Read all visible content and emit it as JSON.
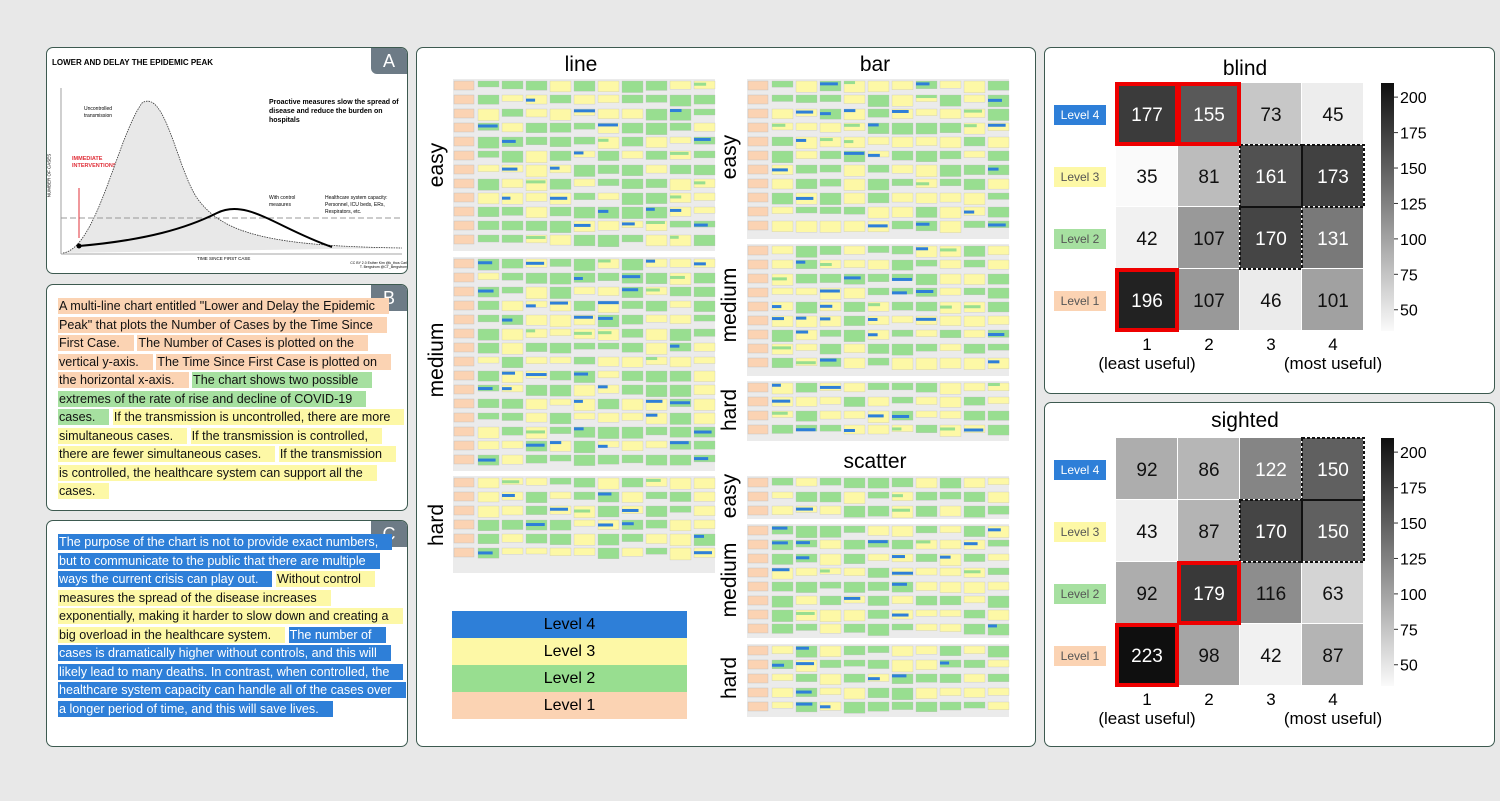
{
  "panel_a": {
    "tag": "A",
    "title": "LOWER AND DELAY THE EPIDEMIC PEAK",
    "subtitle": "Proactive measures slow the spread of disease and reduce the burden on hospitals",
    "uncontrolled": "Uncontrolled transmission",
    "interventions": "IMMEDIATE INTERVENTIONS",
    "control": "With control measures",
    "capacity": "Healthcare system capacity: Personnel, ICU beds, ERs, Respirators, etc.",
    "ylabel": "NUMBER OF CASES",
    "xlabel": "TIME SINCE FIRST CASE",
    "credit": "CC BY 2.0 Esther Kim @k_thos Carl T. Bergstrom @CT_Bergstrom"
  },
  "panel_b": {
    "tag": "B",
    "sentences": [
      {
        "text": "A multi-line chart entitled \"Lower and Delay the Epidemic Peak\" that plots the Number of Cases by the Time Since First Case.",
        "level": "Level 1"
      },
      {
        "text": "The Number of Cases is plotted on the vertical y-axis.",
        "level": "Level 1"
      },
      {
        "text": "The Time Since First Case is plotted on the horizontal x-axis.",
        "level": "Level 1"
      },
      {
        "text": "The chart shows two possible extremes of the rate of rise and decline of COVID-19 cases.",
        "level": "Level 2"
      },
      {
        "text": "If the transmission is uncontrolled, there are more simultaneous cases.",
        "level": "Level 3"
      },
      {
        "text": "If the transmission is controlled, there are fewer simultaneous cases.",
        "level": "Level 3"
      },
      {
        "text": "If the transmission is controlled, the healthcare system can support all the cases.",
        "level": "Level 3"
      }
    ]
  },
  "panel_c": {
    "tag": "C",
    "sentences": [
      {
        "text": "The purpose of the chart is not to provide exact numbers, but to communicate to the public that there are multiple ways the current crisis can play out.",
        "level": "Level 4"
      },
      {
        "text": "Without control measures the spread of the disease increases exponentially, making it harder to slow down and creating a big overload in the healthcare system.",
        "level": "Level 3"
      },
      {
        "text": "The number of cases is dramatically higher without controls, and this will likely lead to many deaths. In contrast, when controlled, the healthcare system capacity can handle all of the cases over a longer period of time, and this will save lives.",
        "level": "Level 4"
      }
    ]
  },
  "middle": {
    "line_title": "line",
    "bar_title": "bar",
    "scatter_title": "scatter",
    "easy": "easy",
    "medium": "medium",
    "hard": "hard",
    "legend": [
      {
        "label": "Level 4",
        "color": "#2e7fd8"
      },
      {
        "label": "Level 3",
        "color": "#fdf8a6"
      },
      {
        "label": "Level 2",
        "color": "#98de90"
      },
      {
        "label": "Level 1",
        "color": "#fbd3b3"
      }
    ]
  },
  "level_colors": {
    "Level 4": "#2e7fd8",
    "Level 3": "#fdf8a6",
    "Level 2": "#a6e0a0",
    "Level 1": "#fbd3b3"
  },
  "chart_data": [
    {
      "type": "heatmap",
      "title": "blind",
      "rows": [
        "Level 4",
        "Level 3",
        "Level 2",
        "Level 1"
      ],
      "columns": [
        "1",
        "2",
        "3",
        "4"
      ],
      "xlabel_left": "(least useful)",
      "xlabel_right": "(most useful)",
      "values": [
        [
          177,
          155,
          73,
          45
        ],
        [
          35,
          81,
          161,
          173
        ],
        [
          42,
          107,
          170,
          131
        ],
        [
          196,
          107,
          46,
          101
        ]
      ],
      "red_outlined": [
        [
          0,
          0
        ],
        [
          0,
          1
        ],
        [
          3,
          0
        ]
      ],
      "dotted_outlined": [
        [
          1,
          2
        ],
        [
          1,
          3
        ],
        [
          2,
          2
        ]
      ],
      "colorbar": {
        "ticks": [
          200,
          175,
          150,
          125,
          100,
          75,
          50
        ],
        "range": [
          35,
          210
        ],
        "colormap": "greys"
      }
    },
    {
      "type": "heatmap",
      "title": "sighted",
      "rows": [
        "Level 4",
        "Level 3",
        "Level 2",
        "Level 1"
      ],
      "columns": [
        "1",
        "2",
        "3",
        "4"
      ],
      "xlabel_left": "(least useful)",
      "xlabel_right": "(most useful)",
      "values": [
        [
          92,
          86,
          122,
          150
        ],
        [
          43,
          87,
          170,
          150
        ],
        [
          92,
          179,
          116,
          63
        ],
        [
          223,
          98,
          42,
          87
        ]
      ],
      "red_outlined": [
        [
          2,
          1
        ],
        [
          3,
          0
        ]
      ],
      "dotted_outlined": [
        [
          0,
          3
        ],
        [
          1,
          2
        ],
        [
          1,
          3
        ]
      ],
      "colorbar": {
        "ticks": [
          200,
          175,
          150,
          125,
          100,
          75,
          50
        ],
        "range": [
          35,
          210
        ],
        "colormap": "greys"
      }
    }
  ]
}
